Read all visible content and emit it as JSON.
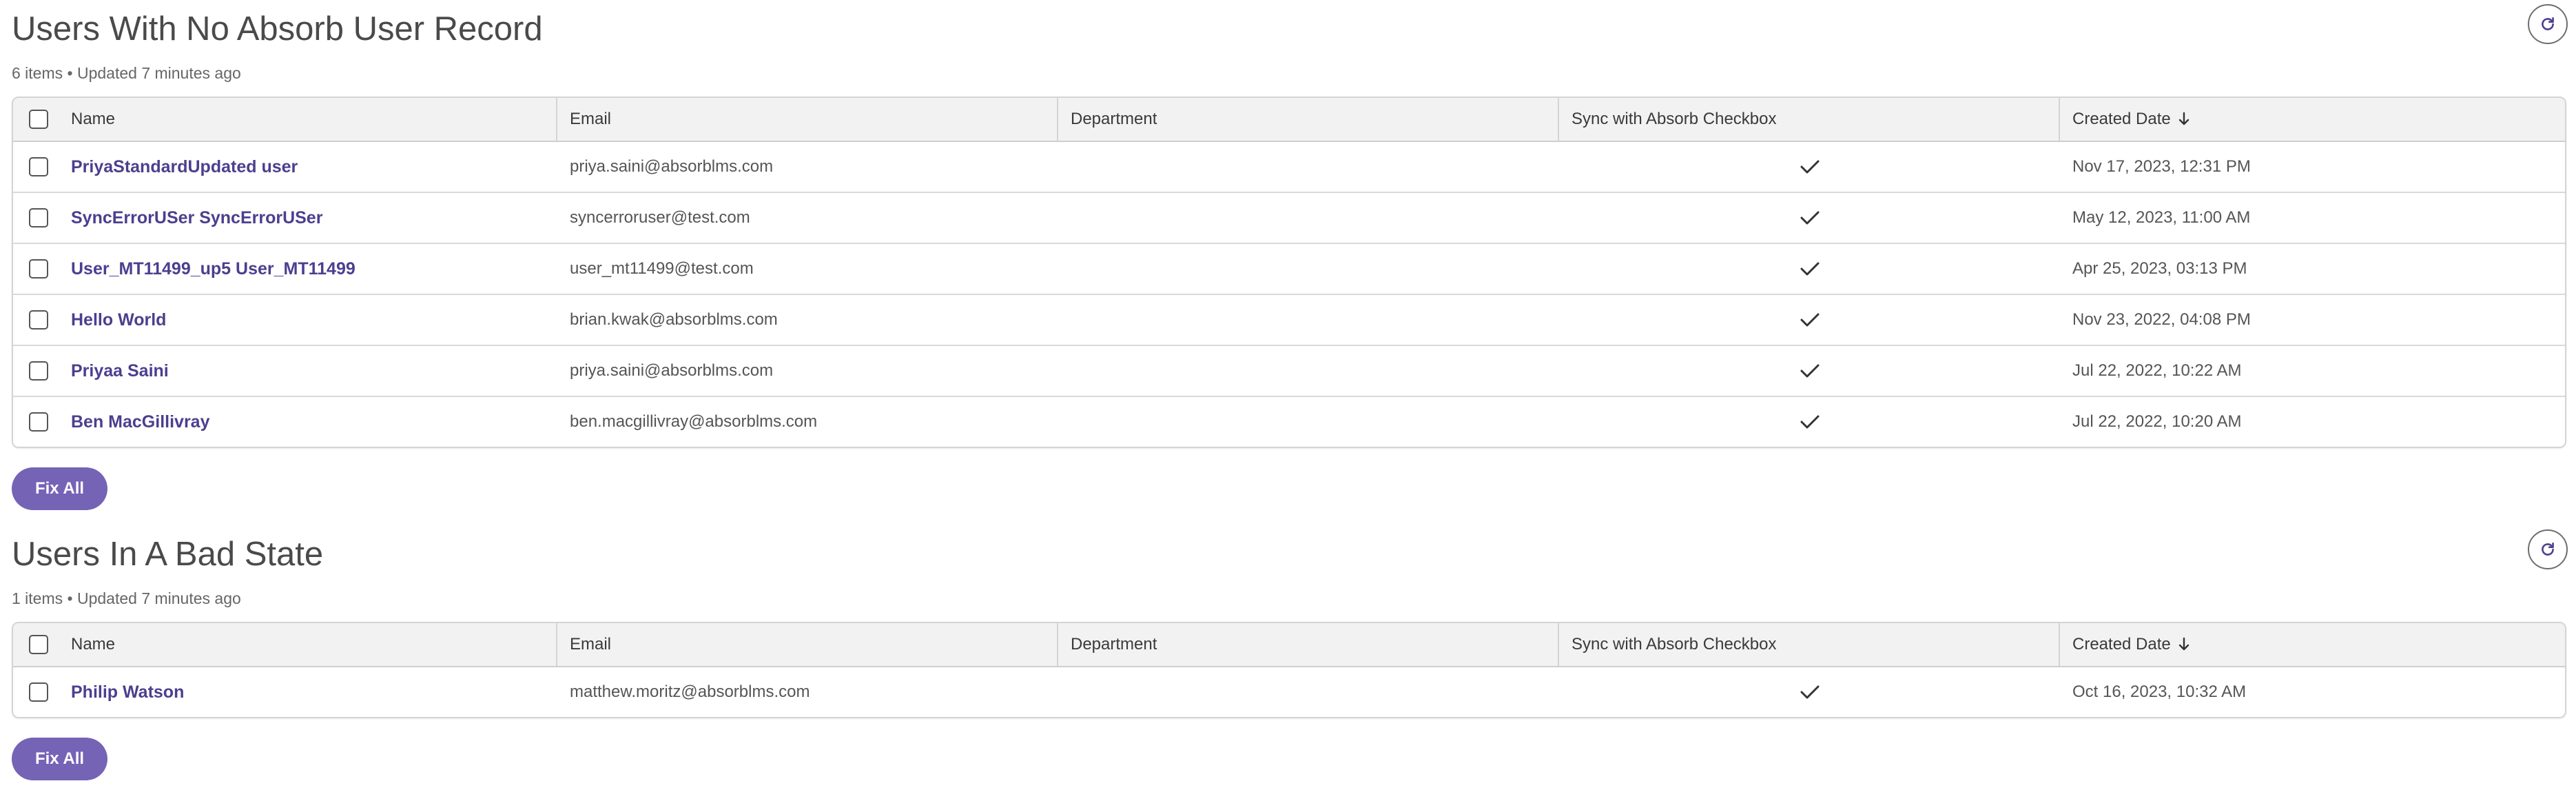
{
  "sections": [
    {
      "title": "Users With No Absorb User Record",
      "meta": "6 items • Updated 7 minutes ago",
      "columns": {
        "name": "Name",
        "email": "Email",
        "department": "Department",
        "sync": "Sync with Absorb Checkbox",
        "created": "Created Date"
      },
      "rows": [
        {
          "name": "PriyaStandardUpdated user",
          "email": "priya.saini@absorblms.com",
          "department": "",
          "synced": true,
          "created": "Nov 17, 2023, 12:31 PM"
        },
        {
          "name": "SyncErrorUSer SyncErrorUSer",
          "email": "syncerroruser@test.com",
          "department": "",
          "synced": true,
          "created": "May 12, 2023, 11:00 AM"
        },
        {
          "name": "User_MT11499_up5 User_MT11499",
          "email": "user_mt11499@test.com",
          "department": "",
          "synced": true,
          "created": "Apr 25, 2023, 03:13 PM"
        },
        {
          "name": "Hello World",
          "email": "brian.kwak@absorblms.com",
          "department": "",
          "synced": true,
          "created": "Nov 23, 2022, 04:08 PM"
        },
        {
          "name": "Priyaa Saini",
          "email": "priya.saini@absorblms.com",
          "department": "",
          "synced": true,
          "created": "Jul 22, 2022, 10:22 AM"
        },
        {
          "name": "Ben MacGillivray",
          "email": "ben.macgillivray@absorblms.com",
          "department": "",
          "synced": true,
          "created": "Jul 22, 2022, 10:20 AM"
        }
      ],
      "fix_label": "Fix All"
    },
    {
      "title": "Users In A Bad State",
      "meta": "1 items • Updated 7 minutes ago",
      "columns": {
        "name": "Name",
        "email": "Email",
        "department": "Department",
        "sync": "Sync with Absorb Checkbox",
        "created": "Created Date"
      },
      "rows": [
        {
          "name": "Philip Watson",
          "email": "matthew.moritz@absorblms.com",
          "department": "",
          "synced": true,
          "created": "Oct 16, 2023, 10:32 AM"
        }
      ],
      "fix_label": "Fix All"
    }
  ],
  "icons": {
    "refresh": "refresh-icon",
    "check": "check-icon",
    "sort": "arrow-down-icon"
  },
  "colors": {
    "accent": "#7563b6",
    "link": "#4b3f8f",
    "header_bg": "#f2f2f2"
  }
}
